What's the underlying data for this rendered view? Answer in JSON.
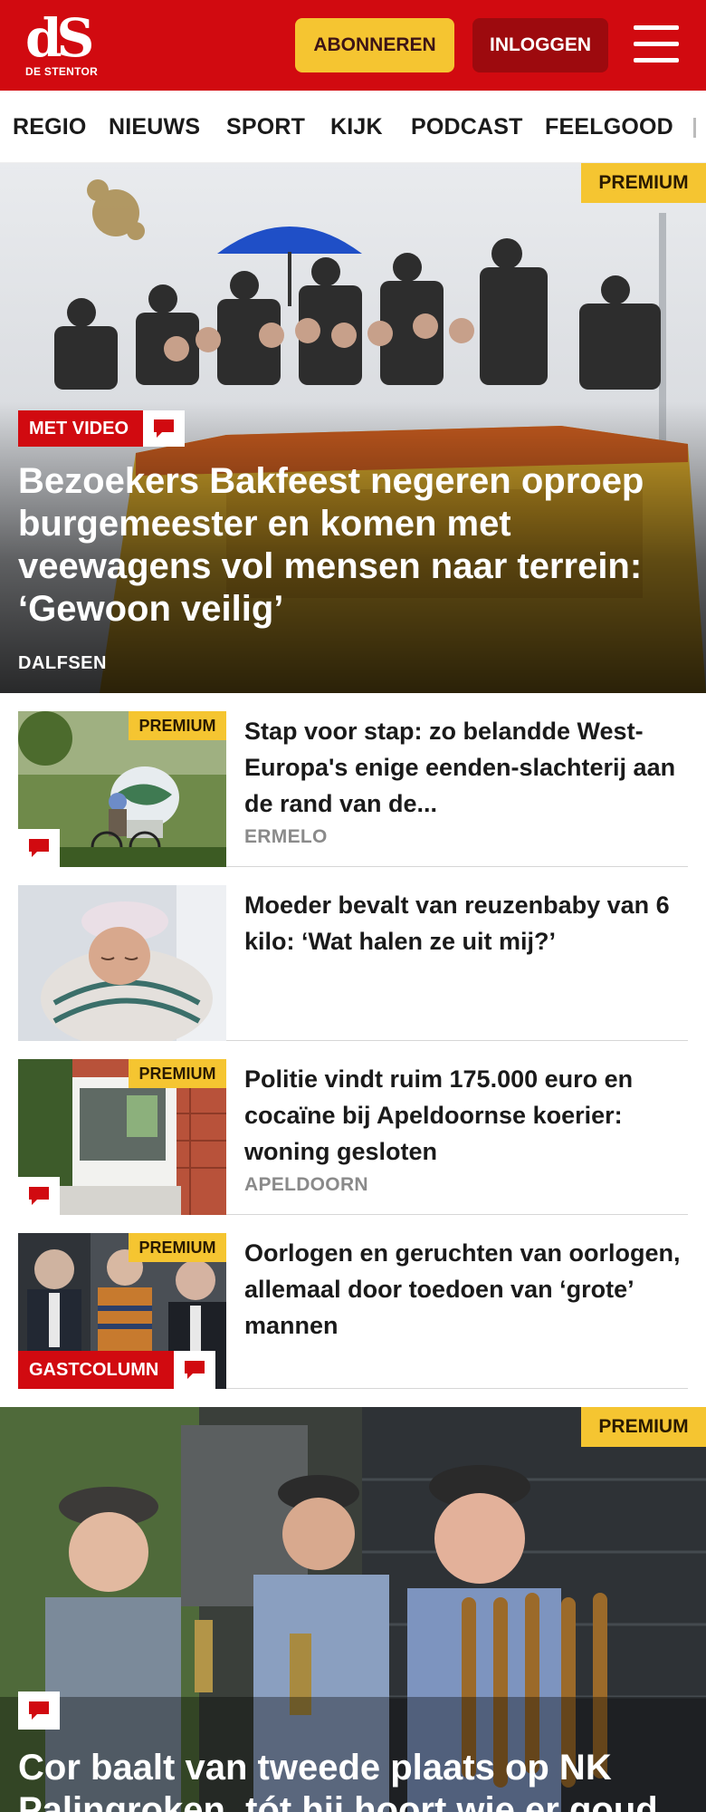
{
  "header": {
    "logo_mark": "dS",
    "logo_sub": "DE STENTOR",
    "subscribe_label": "ABONNEREN",
    "login_label": "INLOGGEN",
    "menu_icon": "hamburger-icon",
    "brand_color": "#d10a10",
    "accent_color": "#f5c531"
  },
  "nav": {
    "items": [
      "REGIO",
      "NIEUWS",
      "SPORT",
      "KIJK",
      "PODCAST",
      "FEELGOOD"
    ]
  },
  "hero": {
    "premium_label": "PREMIUM",
    "badge_label": "MET VIDEO",
    "badge_icon": "comment-icon",
    "title": "Bezoekers Bakfeest negeren oproep burgemeester en komen met veewagens vol mensen naar terrein: ‘Gewoon veilig’",
    "location": "DALFSEN"
  },
  "articles": [
    {
      "premium_label": "PREMIUM",
      "title": "Stap voor stap: zo belandde West-Europa's enige eenden-slachterij aan de rand van de...",
      "location": "ERMELO",
      "icon": "comment-icon"
    },
    {
      "title": "Moeder bevalt van reuzenbaby van 6 kilo: ‘Wat halen ze uit mij?’"
    },
    {
      "premium_label": "PREMIUM",
      "title": "Politie vindt ruim 175.000 euro en cocaïne bij Apeldoornse koerier: woning gesloten",
      "location": "APELDOORN",
      "icon": "comment-icon"
    },
    {
      "premium_label": "PREMIUM",
      "badge_label": "GASTCOLUMN",
      "title": "Oorlogen en geruchten van oorlogen, allemaal door toedoen van ‘grote’ mannen",
      "icon": "comment-icon"
    }
  ],
  "hero2": {
    "premium_label": "PREMIUM",
    "title": "Cor baalt van tweede plaats op NK Palingroken, tót hij hoort wie er goud",
    "icon": "comment-icon"
  }
}
